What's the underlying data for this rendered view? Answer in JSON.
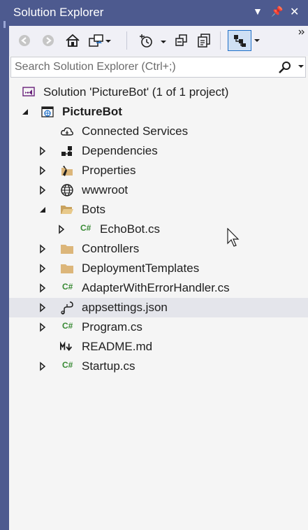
{
  "panel": {
    "title": "Solution Explorer"
  },
  "search": {
    "placeholder": "Search Solution Explorer (Ctrl+;)"
  },
  "tree": {
    "solution_label": "Solution 'PictureBot' (1 of 1 project)",
    "project_label": "PictureBot",
    "items": [
      {
        "label": "Connected Services"
      },
      {
        "label": "Dependencies"
      },
      {
        "label": "Properties"
      },
      {
        "label": "wwwroot"
      },
      {
        "label": "Bots"
      },
      {
        "label": "EchoBot.cs"
      },
      {
        "label": "Controllers"
      },
      {
        "label": "DeploymentTemplates"
      },
      {
        "label": "AdapterWithErrorHandler.cs"
      },
      {
        "label": "appsettings.json"
      },
      {
        "label": "Program.cs"
      },
      {
        "label": "README.md"
      },
      {
        "label": "Startup.cs"
      }
    ],
    "selected_item": "appsettings.json"
  },
  "icons": {
    "solution": "visual-studio-solution-icon",
    "project": "web-project-icon",
    "connected": "cloud-icon",
    "dependencies": "dependencies-icon",
    "properties": "wrench-folder-icon",
    "wwwroot": "globe-icon",
    "folder": "folder-icon",
    "csharp": "csharp-file-icon",
    "json": "json-file-icon",
    "markdown": "markdown-file-icon"
  },
  "colors": {
    "title_bar": "#4d5a8f",
    "panel_bg": "#f5f5f5",
    "selected_row": "#e4e5eb",
    "folder": "#dcb67a",
    "csharp": "#388a34"
  }
}
